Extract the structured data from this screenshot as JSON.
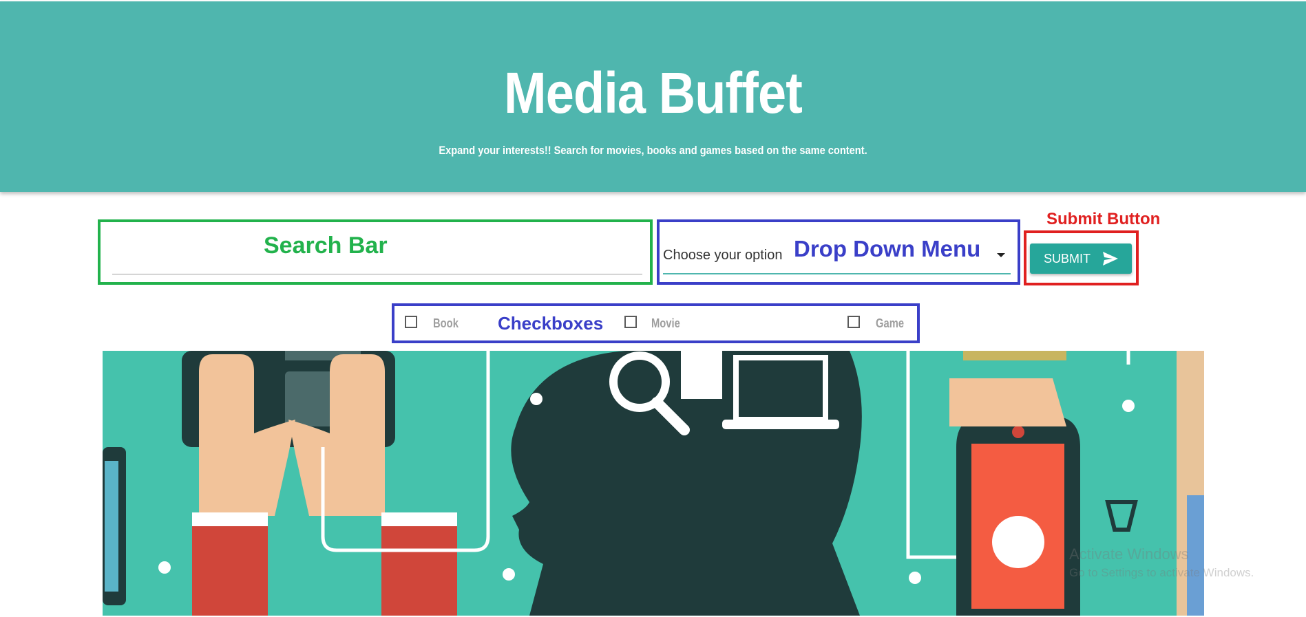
{
  "header": {
    "title": "Media Buffet",
    "subtitle": "Expand your interests!! Search for movies, books and games based on the same content."
  },
  "annotations": {
    "search": "Search Bar",
    "dropdown": "Drop Down Menu",
    "submit": "Submit Button",
    "checkboxes": "Checkboxes"
  },
  "search": {
    "value": ""
  },
  "dropdown": {
    "selected": "Choose your option"
  },
  "submit": {
    "label": "SUBMIT",
    "icon": "send-icon"
  },
  "checkboxes": [
    {
      "label": "Book",
      "checked": false
    },
    {
      "label": "Movie",
      "checked": false
    },
    {
      "label": "Game",
      "checked": false
    }
  ],
  "watermark": {
    "line1": "Activate Windows",
    "line2": "Go to Settings to activate Windows."
  },
  "colors": {
    "header": "#4fb6ae",
    "accent": "#26a69a",
    "annotation_green": "#22b24c",
    "annotation_blue": "#3a3fc8",
    "annotation_red": "#e02020"
  }
}
